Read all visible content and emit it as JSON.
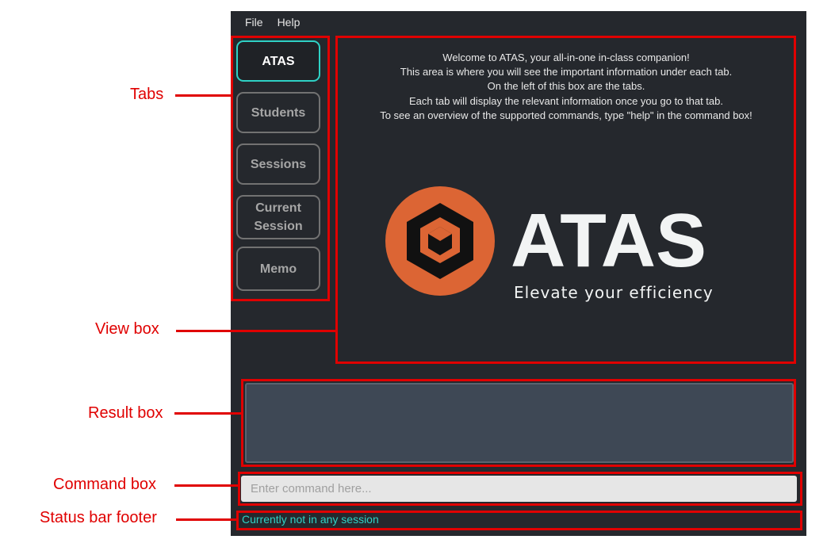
{
  "menu": {
    "file": "File",
    "help": "Help"
  },
  "tabs": [
    {
      "label": "ATAS",
      "active": true
    },
    {
      "label": "Students",
      "active": false
    },
    {
      "label": "Sessions",
      "active": false
    },
    {
      "label": "Current Session",
      "active": false
    },
    {
      "label": "Memo",
      "active": false
    }
  ],
  "welcome": [
    "Welcome to ATAS, your all-in-one in-class companion!",
    "This area is where you will see the important information under each tab.",
    "On the left of this box are the tabs.",
    "Each tab will display the relevant information once you go to that tab.",
    "To see an overview of the supported commands, type \"help\" in the command box!"
  ],
  "logo": {
    "name": "ATAS",
    "tagline": "Elevate your efficiency",
    "accent": "#dc6534"
  },
  "command": {
    "placeholder": "Enter command here..."
  },
  "status": {
    "text": "Currently not in any session"
  },
  "annotations": {
    "tabs": "Tabs",
    "view": "View box",
    "result": "Result box",
    "command": "Command box",
    "status": "Status bar footer"
  },
  "colors": {
    "annotation": "#e00000",
    "active_tab_border": "#2fd1c5",
    "status_text": "#2fd1c5",
    "background": "#25282d"
  }
}
